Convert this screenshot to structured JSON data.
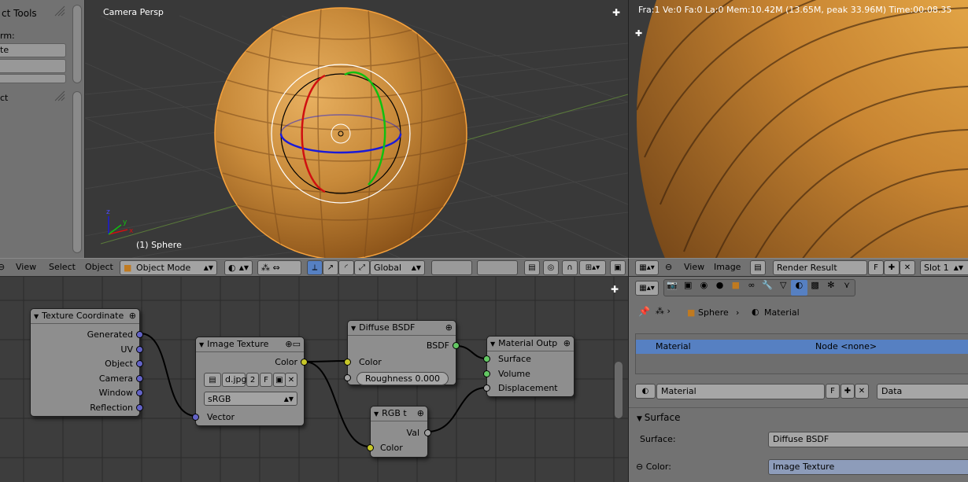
{
  "toolshelf": {
    "tab_title": "ct Tools",
    "transform_label": "rm:",
    "btn1": "te",
    "object_label": "ct"
  },
  "viewport": {
    "title": "Camera Persp",
    "object_label": "(1) Sphere",
    "axis_x": "x",
    "axis_y": "y",
    "axis_z": "z"
  },
  "viewport_header": {
    "view": "View",
    "select": "Select",
    "object": "Object",
    "mode": "Object Mode",
    "orientation": "Global"
  },
  "render": {
    "stats": "Fra:1  Ve:0 Fa:0 La:0 Mem:10.42M (13.65M, peak 33.96M) Time:00:08.35"
  },
  "render_header": {
    "view": "View",
    "image": "Image",
    "image_name": "Render Result",
    "fake_user": "F",
    "slot": "Slot 1"
  },
  "nodes": {
    "tex_coord": {
      "title": "Texture Coordinate",
      "outputs": [
        "Generated",
        "UV",
        "Object",
        "Camera",
        "Window",
        "Reflection"
      ]
    },
    "image_texture": {
      "title": "Image Texture",
      "output": "Color",
      "image_name": "d.jpg",
      "users": "2",
      "fake": "F",
      "colorspace": "sRGB",
      "input": "Vector"
    },
    "diffuse": {
      "title": "Diffuse BSDF",
      "output": "BSDF",
      "input_color": "Color",
      "roughness": "Roughness 0.000"
    },
    "rgb": {
      "title": "RGB t",
      "output": "Val",
      "input": "Color"
    },
    "material_output": {
      "title": "Material Outp",
      "inputs": [
        "Surface",
        "Volume",
        "Displacement"
      ]
    }
  },
  "props": {
    "breadcrumb_object": "Sphere",
    "breadcrumb_material": "Material",
    "slot_material": "Material",
    "slot_node": "Node <none>",
    "material_name": "Material",
    "fake": "F",
    "link": "Data",
    "surface_panel": "Surface",
    "surface_label": "Surface:",
    "surface_value": "Diffuse BSDF",
    "color_label": "Color:",
    "color_value": "Image Texture"
  },
  "colors": {
    "select_blue": "#5680c2",
    "wood": "#c88a3a",
    "background": "#393939"
  }
}
